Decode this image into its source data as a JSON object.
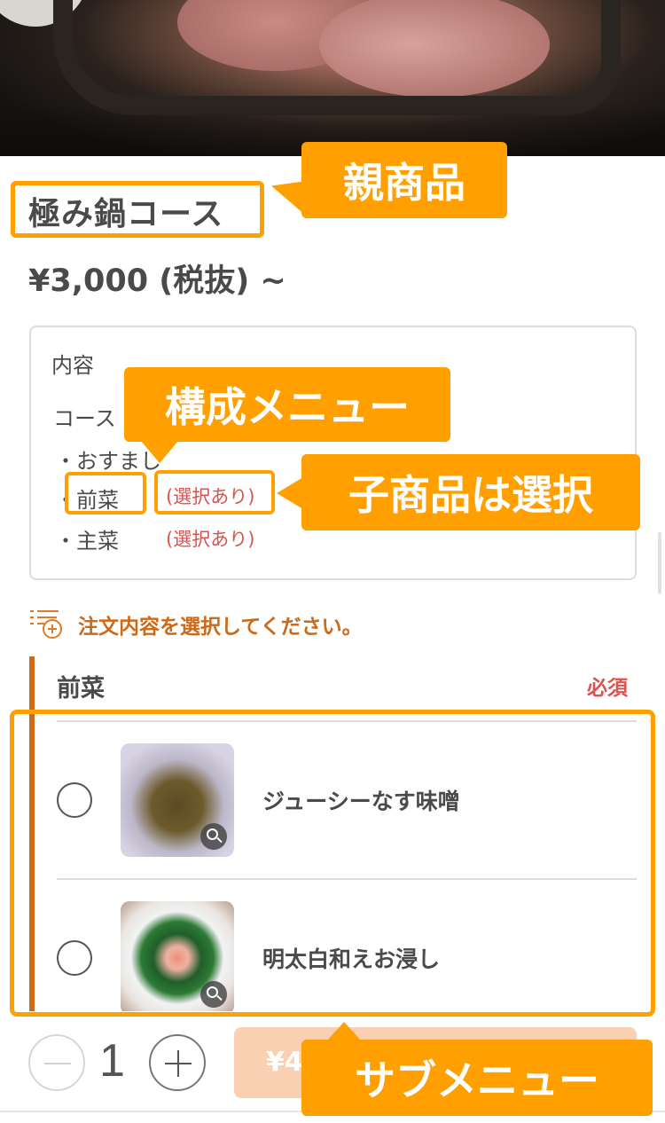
{
  "product": {
    "title": "極み鍋コース",
    "price": "¥3,000 (税抜) ~"
  },
  "contents": {
    "heading": "内容",
    "course_label": "コース",
    "items": [
      {
        "label": "・おすまし"
      },
      {
        "label": "・前菜",
        "selectable": "(選択あり)"
      },
      {
        "label": "・主菜",
        "selectable": "(選択あり)"
      }
    ]
  },
  "prompt": {
    "icon": "list-add-icon",
    "text": "注文内容を選択してください。"
  },
  "section": {
    "title": "前菜",
    "required": "必須",
    "options": [
      {
        "name": "ジューシーなす味噌",
        "selected": false,
        "icon": "zoom-in-icon"
      },
      {
        "name": "明太白和えお浸し",
        "selected": false,
        "icon": "zoom-in-icon"
      }
    ]
  },
  "footer": {
    "quantity": "1",
    "add_button_partial": "¥4"
  },
  "annotations": {
    "parent_product": "親商品",
    "components": "構成メニュー",
    "child_select": "子商品は選択",
    "submenu": "サブメニュー"
  },
  "colors": {
    "annotation_orange": "#ff9f00",
    "accent_orange": "#cc6a1a",
    "required_red": "#d9534f"
  }
}
